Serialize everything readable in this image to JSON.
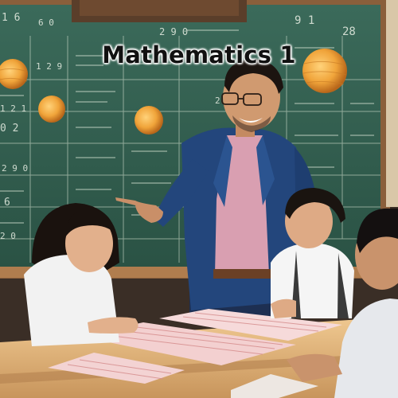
{
  "title": "Mathematics 1",
  "colors": {
    "chalkboard": "#2f5a4b",
    "frame": "#a0714a",
    "planet": "#e89a2a",
    "jacket": "#1f3f70",
    "shirt": "#d9a0b0",
    "table": "#e3b97f"
  }
}
